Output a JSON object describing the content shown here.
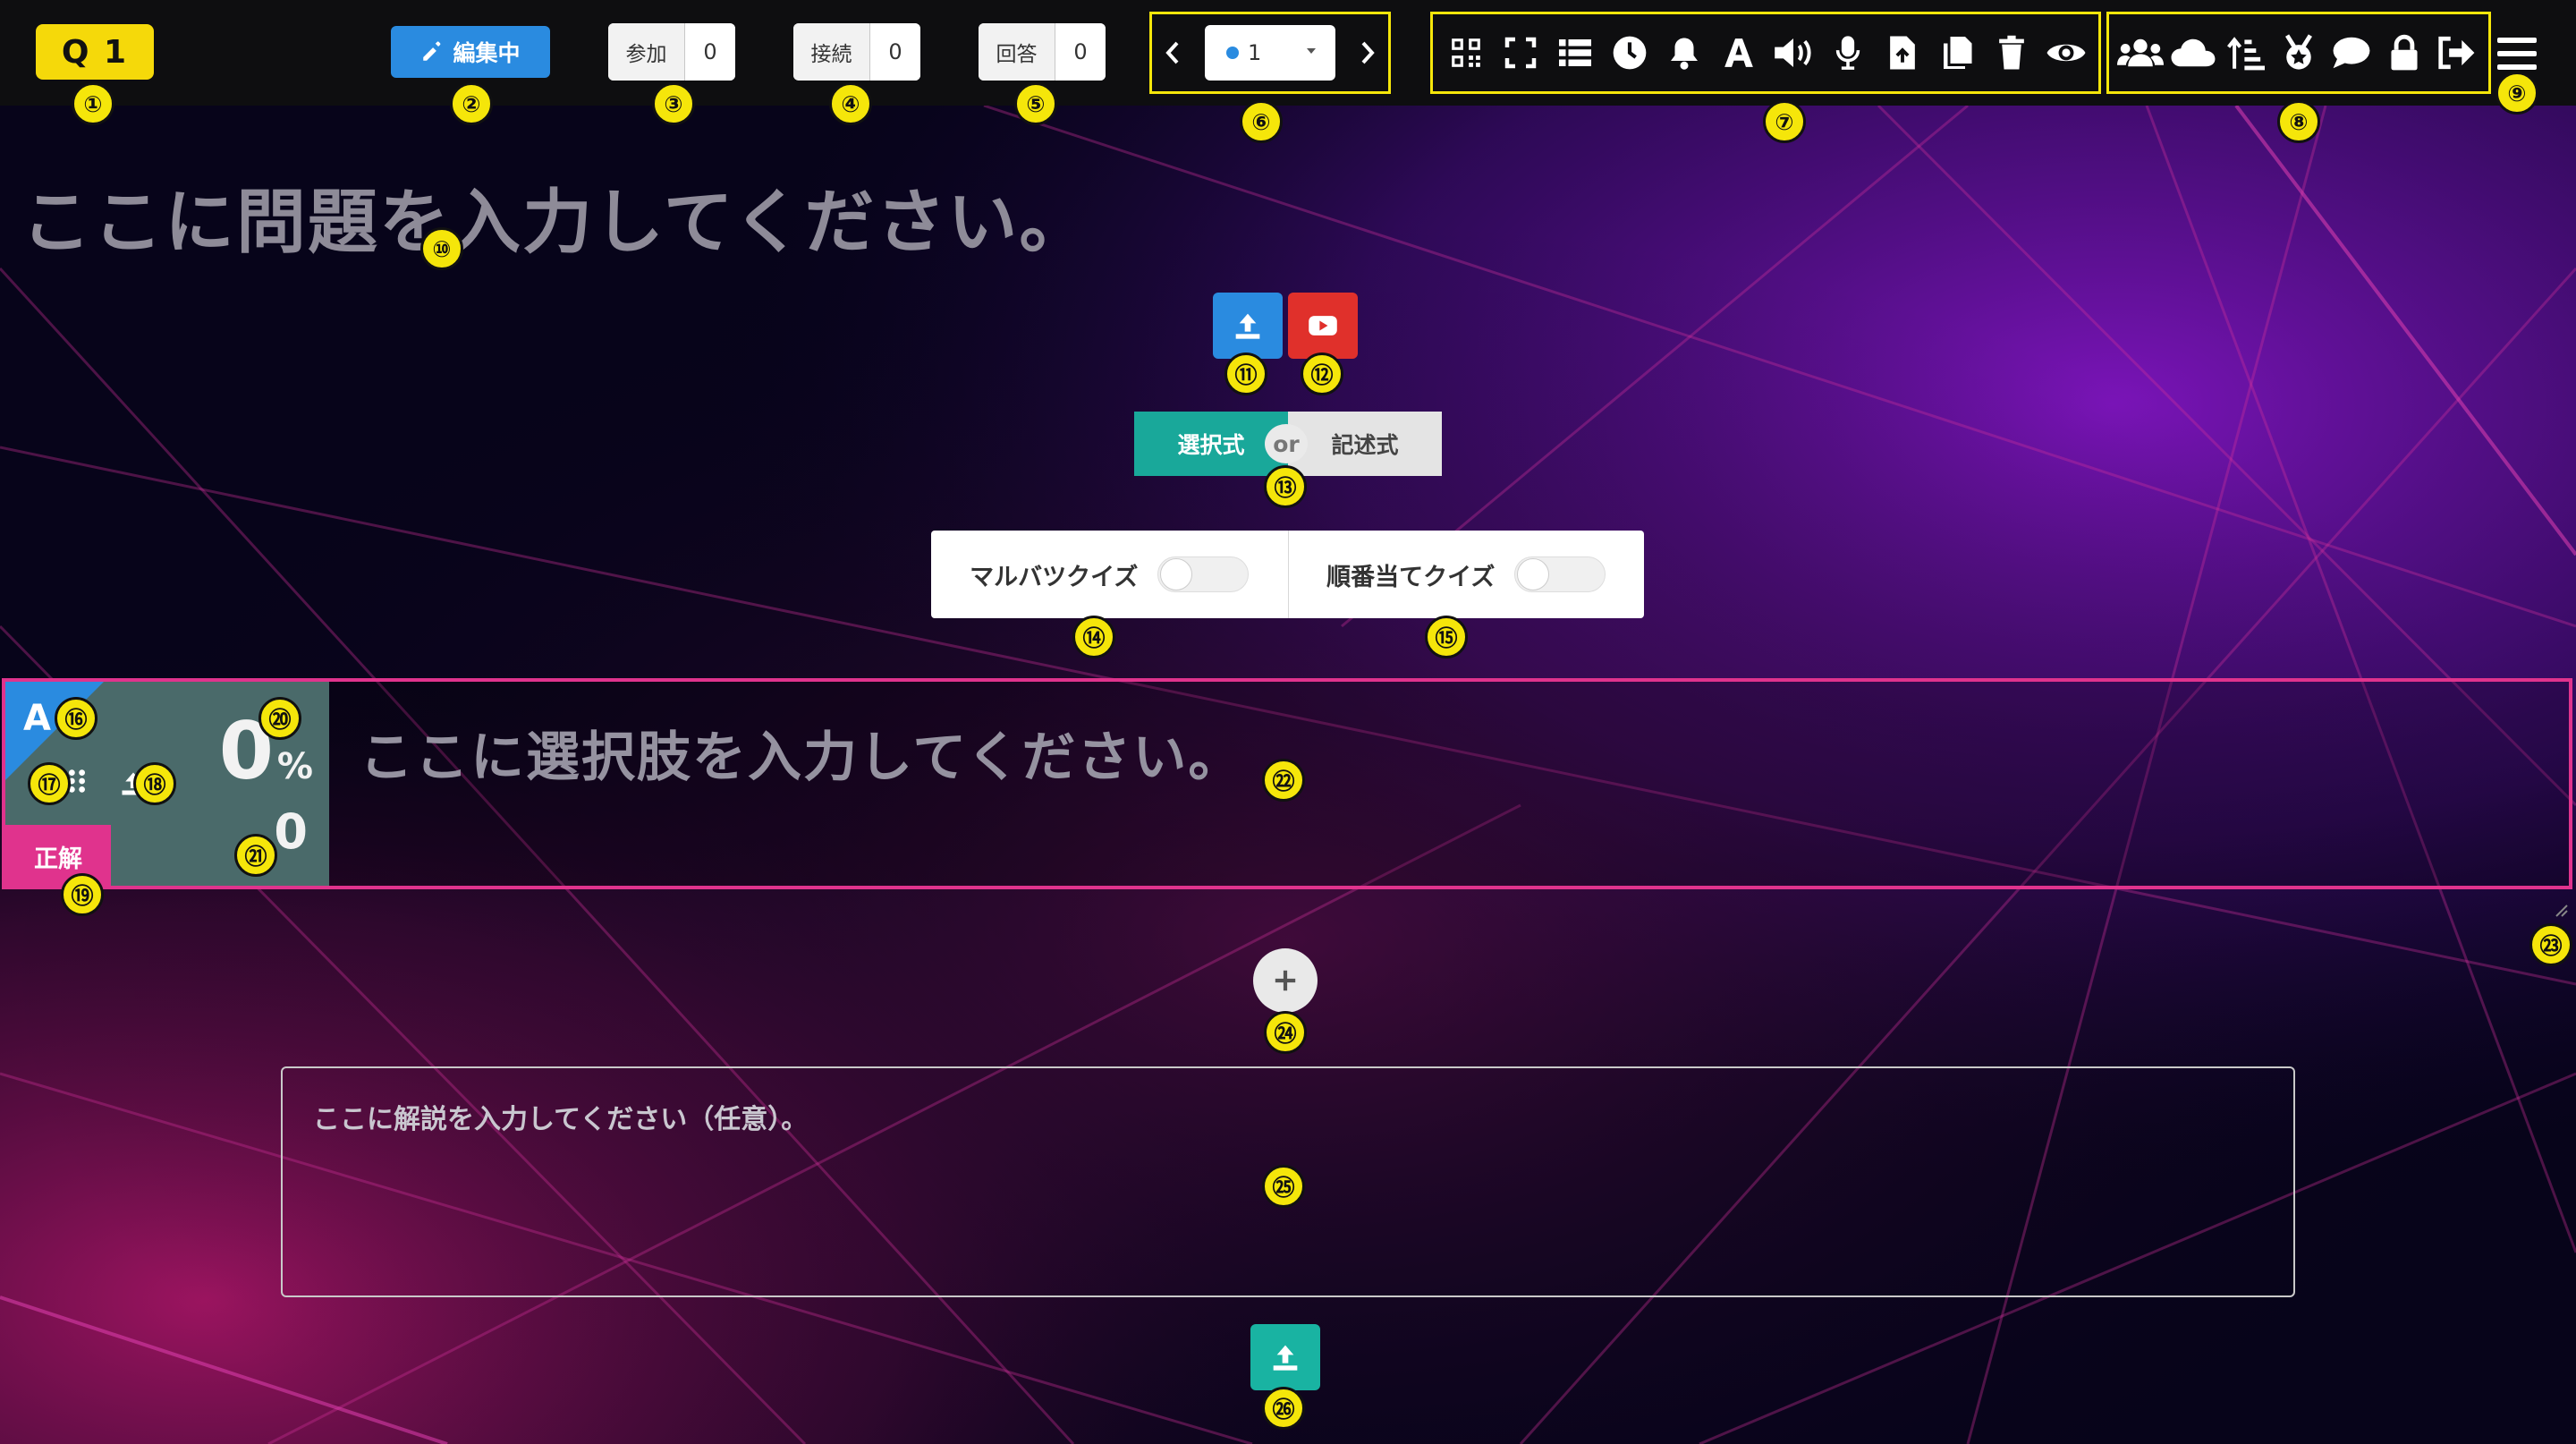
{
  "topbar": {
    "question_number": "Q 1",
    "edit_label": "編集中",
    "join_label": "参加",
    "join_count": "0",
    "connect_label": "接続",
    "connect_count": "0",
    "answer_label": "回答",
    "answer_count": "0",
    "page_select_value": "1",
    "tool_icons": [
      "qr-code-icon",
      "fullscreen-icon",
      "list-icon",
      "clock-icon",
      "bell-icon",
      "font-icon",
      "volume-icon",
      "microphone-icon",
      "file-upload-icon",
      "copy-icon",
      "trash-icon",
      "eye-icon"
    ],
    "tool_icons_2": [
      "users-icon",
      "cloud-icon",
      "sort-icon",
      "medal-icon",
      "comment-icon",
      "lock-icon",
      "sign-out-icon"
    ]
  },
  "question": {
    "placeholder": "ここに問題を入力してください。"
  },
  "answer_type": {
    "choice_label": "選択式",
    "or_label": "or",
    "text_label": "記述式"
  },
  "quiz_modes": {
    "maru_batsu_label": "マルバツクイズ",
    "order_label": "順番当てクイズ"
  },
  "choice": {
    "letter": "A",
    "percent": "0",
    "percent_sign": "%",
    "count": "0",
    "correct_label": "正解",
    "placeholder": "ここに選択肢を入力してください。"
  },
  "explanation": {
    "placeholder": "ここに解説を入力してください（任意）。"
  },
  "markers": [
    "①",
    "②",
    "③",
    "④",
    "⑤",
    "⑥",
    "⑦",
    "⑧",
    "⑨",
    "⑩",
    "⑪",
    "⑫",
    "⑬",
    "⑭",
    "⑮",
    "⑯",
    "⑰",
    "⑱",
    "⑲",
    "⑳",
    "㉑",
    "㉒",
    "㉓",
    "㉔",
    "㉕",
    "㉖"
  ],
  "colors": {
    "accent_yellow": "#f5e60a",
    "edit_blue": "#2a8be0",
    "teal": "#19b3a2",
    "pink": "#e0338d",
    "youtube_red": "#e0302b"
  }
}
